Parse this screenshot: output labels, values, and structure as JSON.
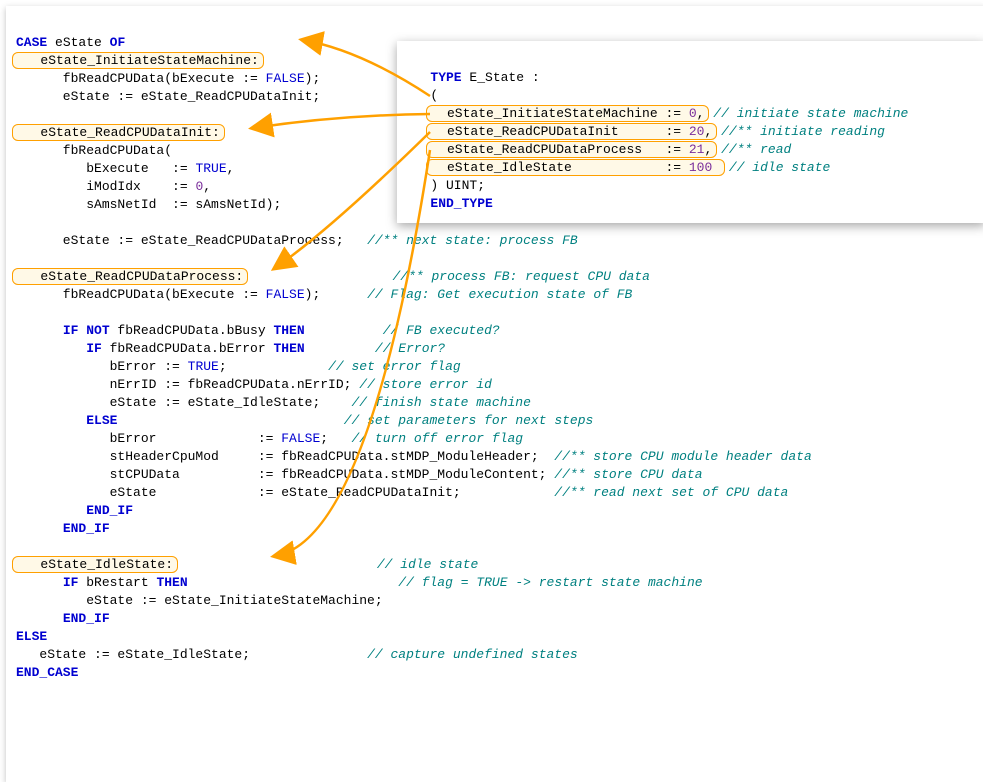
{
  "main": {
    "l01a": "CASE",
    "l01b": " eState ",
    "l01c": "OF",
    "l02": "   eState_InitiateStateMachine:",
    "l03a": "      fbReadCPUData(bExecute := ",
    "l03b": "FALSE",
    "l03c": ");",
    "l04": "      eState := eState_ReadCPUDataInit;",
    "l05": " ",
    "l06": "   eState_ReadCPUDataInit:",
    "l07": "      fbReadCPUData(",
    "l08a": "         bExecute   := ",
    "l08b": "TRUE",
    "l08c": ",",
    "l09a": "         iModIdx    := ",
    "l09b": "0",
    "l09c": ",",
    "l10": "         sAmsNetId  := sAmsNetId);",
    "l11": " ",
    "l12a": "      eState := eState_ReadCPUDataProcess;   ",
    "l12b": "//** next state: process FB",
    "l13": " ",
    "l14a": "   eState_ReadCPUDataProcess:",
    "l14pad": "                   ",
    "l14b": "//** process FB: request CPU data",
    "l15a": "      fbReadCPUData(bExecute := ",
    "l15b": "FALSE",
    "l15c": ");      ",
    "l15d": "// Flag: Get execution state of FB",
    "l16": " ",
    "l17a": "      ",
    "l17b": "IF NOT",
    "l17c": " fbReadCPUData.bBusy ",
    "l17d": "THEN",
    "l17e": "          ",
    "l17f": "// FB executed?",
    "l18a": "         ",
    "l18b": "IF",
    "l18c": " fbReadCPUData.bError ",
    "l18d": "THEN",
    "l18e": "         ",
    "l18f": "// Error?",
    "l19a": "            bError := ",
    "l19b": "TRUE",
    "l19c": ";             ",
    "l19d": "// set error flag",
    "l20a": "            nErrID := fbReadCPUData.nErrID; ",
    "l20b": "// store error id",
    "l21a": "            eState := eState_IdleState;    ",
    "l21b": "// finish state machine",
    "l22a": "         ",
    "l22b": "ELSE",
    "l22c": "                             ",
    "l22d": "// set parameters for next steps",
    "l23a": "            bError             := ",
    "l23b": "FALSE",
    "l23c": ";   ",
    "l23d": "// turn off error flag",
    "l24a": "            stHeaderCpuMod     := fbReadCPUData.stMDP_ModuleHeader;  ",
    "l24b": "//** store CPU module header data",
    "l25a": "            stCPUData          := fbReadCPUData.stMDP_ModuleContent; ",
    "l25b": "//** store CPU data",
    "l26a": "            eState             := eState_ReadCPUDataInit;            ",
    "l26b": "//** read next set of CPU data",
    "l27a": "         ",
    "l27b": "END_IF",
    "l28a": "      ",
    "l28b": "END_IF",
    "l29": " ",
    "l30a": "   eState_IdleState:",
    "l30pad": "                          ",
    "l30b": "// idle state",
    "l31a": "      ",
    "l31b": "IF",
    "l31c": " bRestart ",
    "l31d": "THEN",
    "l31e": "                           ",
    "l31f": "// flag = TRUE -> restart state machine",
    "l32": "         eState := eState_InitiateStateMachine;",
    "l33a": "      ",
    "l33b": "END_IF",
    "l34": "ELSE",
    "l35a": "   eState := eState_IdleState;               ",
    "l35b": "// capture undefined states",
    "l36": "END_CASE"
  },
  "overlay": {
    "o1a": "TYPE",
    "o1b": " E_State :",
    "o2": "(",
    "o3a": "  eState_InitiateStateMachine := ",
    "o3b": "0",
    "o3c": ",",
    "o3d": "// initiate state machine",
    "o4a": "  eState_ReadCPUDataInit      := ",
    "o4b": "20",
    "o4c": ",",
    "o4d": "//** initiate reading",
    "o5a": "  eState_ReadCPUDataProcess   := ",
    "o5b": "21",
    "o5c": ",",
    "o5d": "//** read",
    "o6a": "  eState_IdleState            := ",
    "o6b": "100",
    "o6c": " ",
    "o6d": "// idle state",
    "o7": ") UINT;",
    "o8": "END_TYPE"
  }
}
